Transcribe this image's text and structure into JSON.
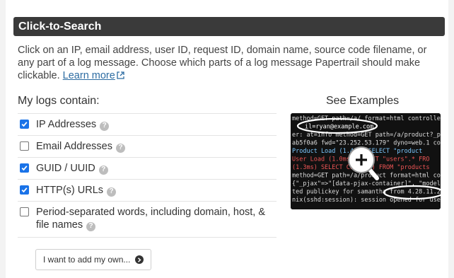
{
  "header": {
    "title": "Click-to-Search"
  },
  "description": {
    "text": "Click on an IP, email address, user ID, request ID, domain name, source code filename, or any part of a log message. Choose which parts of a log message Papertrail should make clickable.",
    "learn_more": "Learn more"
  },
  "logs": {
    "title": "My logs contain:",
    "options": [
      {
        "label": "IP Addresses",
        "checked": true
      },
      {
        "label": "Email Addresses",
        "checked": false
      },
      {
        "label": "GUID / UUID",
        "checked": true
      },
      {
        "label": "HTTP(s) URLs",
        "checked": true
      },
      {
        "label": "Period-separated words, including domain, host, & file names",
        "checked": false
      }
    ]
  },
  "add_button": {
    "label": "I want to add my own..."
  },
  "examples": {
    "title": "See Examples",
    "lines": [
      "method=GET path=/a/ format=html controller=",
      "il=ryan@example.com",
      "er: at=info method=GET path=/a/product?_pje",
      "ab5f0a6 fwd=\"23.252.53.179\" dyno=web.1 conne",
      "Product Load (1.4ms)  SELECT \"product",
      "User Load (1.0ms)  SELECT \"users\".* FRO",
      "(1.3ms)  SELECT COUNT(*) FROM \"products",
      "method=GET path=/a/product format=html cont",
      "{\"_pjax\"=>\"[data-pjax-container]\", \"model",
      "ted publickey for samantha from 4.28.11.28",
      "nix(sshd:session): session opened for user"
    ],
    "highlight_ip": "om 4.28.11.28"
  },
  "colors": {
    "header_bg": "#3a3a3a",
    "link": "#2d6ca2",
    "checkbox": "#1a73e8"
  }
}
